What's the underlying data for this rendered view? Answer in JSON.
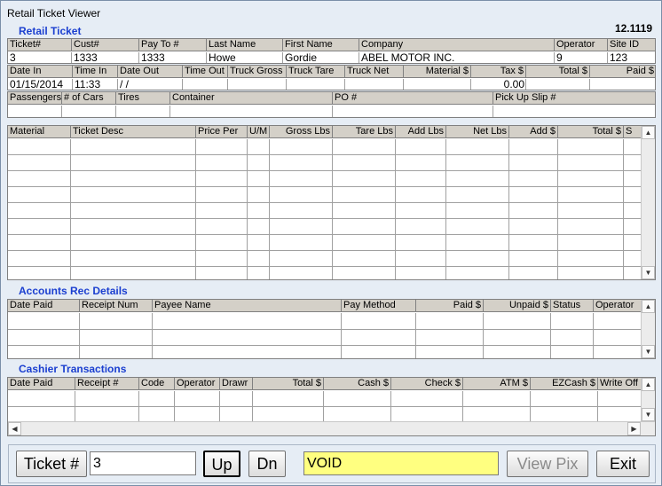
{
  "window": {
    "title": "Retail Ticket Viewer",
    "version": "12.1119"
  },
  "retail": {
    "section": "Retail Ticket",
    "row1": {
      "headers": [
        "Ticket#",
        "Cust#",
        "Pay To #",
        "Last Name",
        "First Name",
        "Company",
        "Operator",
        "Site ID"
      ],
      "values": [
        "3",
        "1333",
        "1333",
        "Howe",
        "Gordie",
        "ABEL MOTOR INC.",
        "9",
        "123"
      ]
    },
    "row2": {
      "headers": [
        "Date In",
        "Time In",
        "Date Out",
        "Time Out",
        "Truck Gross",
        "Truck Tare",
        "Truck Net",
        "Material $",
        "Tax $",
        "Total $",
        "Paid $"
      ],
      "values": [
        "01/15/2014",
        "11:33",
        "/ /",
        "",
        "",
        "",
        "",
        "",
        "0.00",
        "",
        ""
      ]
    },
    "row3": {
      "headers": [
        "Passengers",
        "# of Cars",
        "Tires",
        "Container",
        "PO #",
        "Pick Up Slip #"
      ],
      "values": [
        "",
        "",
        "",
        "",
        "",
        ""
      ]
    }
  },
  "lines_grid": {
    "headers": [
      "Material",
      "Ticket Desc",
      "Price Per",
      "U/M",
      "Gross Lbs",
      "Tare Lbs",
      "Add Lbs",
      "Net Lbs",
      "Add $",
      "Total $",
      "S"
    ]
  },
  "ar": {
    "section": "Accounts Rec Details",
    "headers": [
      "Date Paid",
      "Receipt Num",
      "Payee Name",
      "Pay Method",
      "Paid $",
      "Unpaid  $",
      "Status",
      "Operator"
    ]
  },
  "cashier": {
    "section": "Cashier Transactions",
    "headers": [
      "Date Paid",
      "Receipt #",
      "Code",
      "Operator",
      "Drawr",
      "Total $",
      "Cash $",
      "Check $",
      "ATM $",
      "EZCash $",
      "Write Off"
    ]
  },
  "bottom": {
    "ticket_label": "Ticket #",
    "ticket_value": "3",
    "up": "Up",
    "dn": "Dn",
    "status": "VOID",
    "viewpix": "View Pix",
    "exit": "Exit"
  },
  "colors": {
    "section_blue": "#1b3fd0",
    "void_bg": "#ffff80",
    "header_gray": "#d4d0c8"
  }
}
